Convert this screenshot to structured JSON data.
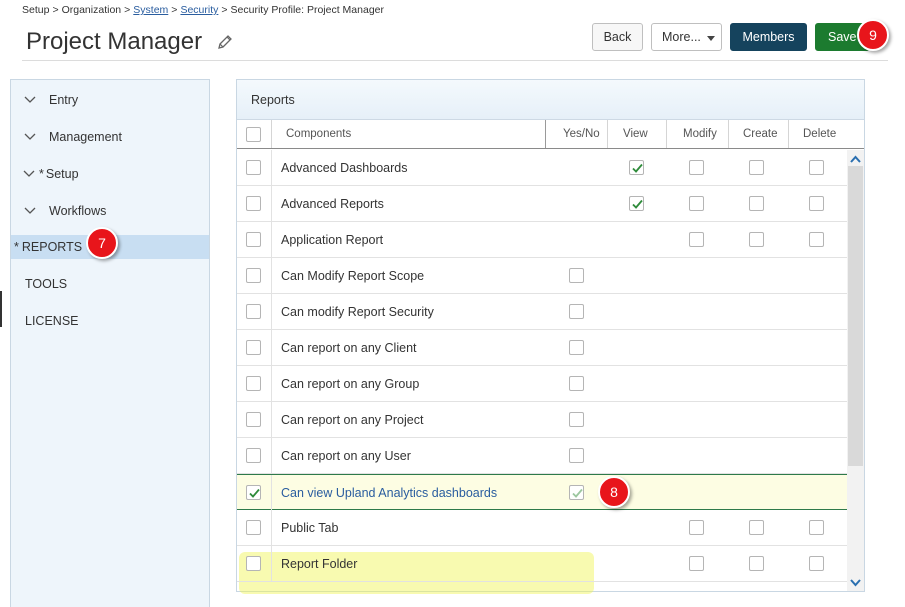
{
  "breadcrumb": {
    "items": [
      "Setup",
      "Organization",
      "System",
      "Security",
      "Security Profile: Project Manager"
    ],
    "separator": ">"
  },
  "page": {
    "title": "Project Manager"
  },
  "header_buttons": {
    "back": "Back",
    "more": "More...",
    "members": "Members",
    "save": "Save"
  },
  "sidebar": {
    "items": [
      {
        "label": "Entry",
        "expandable": true
      },
      {
        "label": "Management",
        "expandable": true
      },
      {
        "label": "Setup",
        "expandable": true,
        "marker": "*"
      },
      {
        "label": "Workflows",
        "expandable": true
      },
      {
        "label": "REPORTS",
        "expandable": false,
        "marker": "*",
        "active": true
      },
      {
        "label": "TOOLS",
        "expandable": false
      },
      {
        "label": "LICENSE",
        "expandable": false
      }
    ]
  },
  "panel": {
    "title": "Reports",
    "columns": {
      "components": "Components",
      "yesno": "Yes/No",
      "view": "View",
      "modify": "Modify",
      "create": "Create",
      "delete": "Delete"
    },
    "rows": [
      {
        "name": "Advanced Dashboards",
        "select": false,
        "view": true,
        "modify": false,
        "create": false,
        "delete": false,
        "type": "crud"
      },
      {
        "name": "Advanced Reports",
        "select": false,
        "view": true,
        "modify": false,
        "create": false,
        "delete": false,
        "type": "crud"
      },
      {
        "name": "Application Report",
        "select": false,
        "type": "mcd",
        "modify": false,
        "create": false,
        "delete": false
      },
      {
        "name": "Can Modify Report Scope",
        "select": false,
        "type": "yesno",
        "yesno": false
      },
      {
        "name": "Can modify Report Security",
        "select": false,
        "type": "yesno",
        "yesno": false
      },
      {
        "name": "Can report on any Client",
        "select": false,
        "type": "yesno",
        "yesno": false
      },
      {
        "name": "Can report on any Group",
        "select": false,
        "type": "yesno",
        "yesno": false
      },
      {
        "name": "Can report on any Project",
        "select": false,
        "type": "yesno",
        "yesno": false
      },
      {
        "name": "Can report on any User",
        "select": false,
        "type": "yesno",
        "yesno": false
      },
      {
        "name": "Can view Upland Analytics dashboards",
        "select": true,
        "type": "yesno",
        "yesno": true,
        "highlighted": true
      },
      {
        "name": "Public Tab",
        "select": false,
        "type": "mcd",
        "modify": false,
        "create": false,
        "delete": false
      },
      {
        "name": "Report Folder",
        "select": false,
        "type": "mcd",
        "modify": false,
        "create": false,
        "delete": false
      }
    ]
  },
  "callouts": {
    "sidebar": "7",
    "row": "8",
    "save": "9"
  },
  "colors": {
    "members_button": "#15435d",
    "save_button": "#1c7b2f",
    "callout": "#e8151b",
    "check_green": "#2e8b3a",
    "sidebar_bg": "#eef5fb",
    "sidebar_active": "#c8def2"
  },
  "icons": {
    "edit": "pencil-icon",
    "chevron": "chevron-down-icon",
    "check": "checkmark-icon",
    "scroll_up": "chevron-up-icon",
    "scroll_down": "chevron-down-icon"
  }
}
